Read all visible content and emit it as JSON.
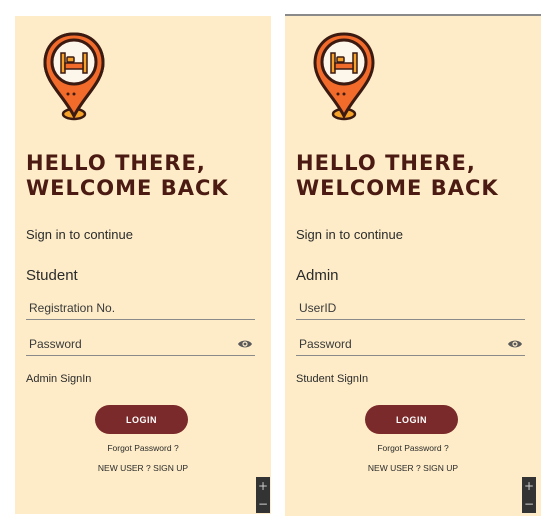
{
  "colors": {
    "background": "#fdecc7",
    "headline": "#4b1a12",
    "primary_button": "#7a2a2a",
    "logo_orange": "#f26b2a",
    "logo_outline": "#3b1a12"
  },
  "icons": {
    "logo": "map-pin-bed-icon",
    "password_toggle": "eye-icon",
    "zoom_in": "plus-icon",
    "zoom_out": "minus-icon"
  },
  "screens": [
    {
      "headline": "HELLO THERE,\nWELCOME BACK",
      "subtitle": "Sign in to continue",
      "role": "Student",
      "id_placeholder": "Registration No.",
      "password_placeholder": "Password",
      "switch_link": "Admin SignIn",
      "login_label": "LOGIN",
      "forgot_label": "Forgot Password ?",
      "signup_label": "NEW USER ? SIGN UP"
    },
    {
      "headline": "HELLO THERE,\nWELCOME BACK",
      "subtitle": "Sign in to continue",
      "role": "Admin",
      "id_placeholder": "UserID",
      "password_placeholder": "Password",
      "switch_link": "Student SignIn",
      "login_label": "LOGIN",
      "forgot_label": "Forgot Password ?",
      "signup_label": "NEW USER ? SIGN UP"
    }
  ],
  "zoom_controls": {
    "plus": "+",
    "minus": "−"
  }
}
